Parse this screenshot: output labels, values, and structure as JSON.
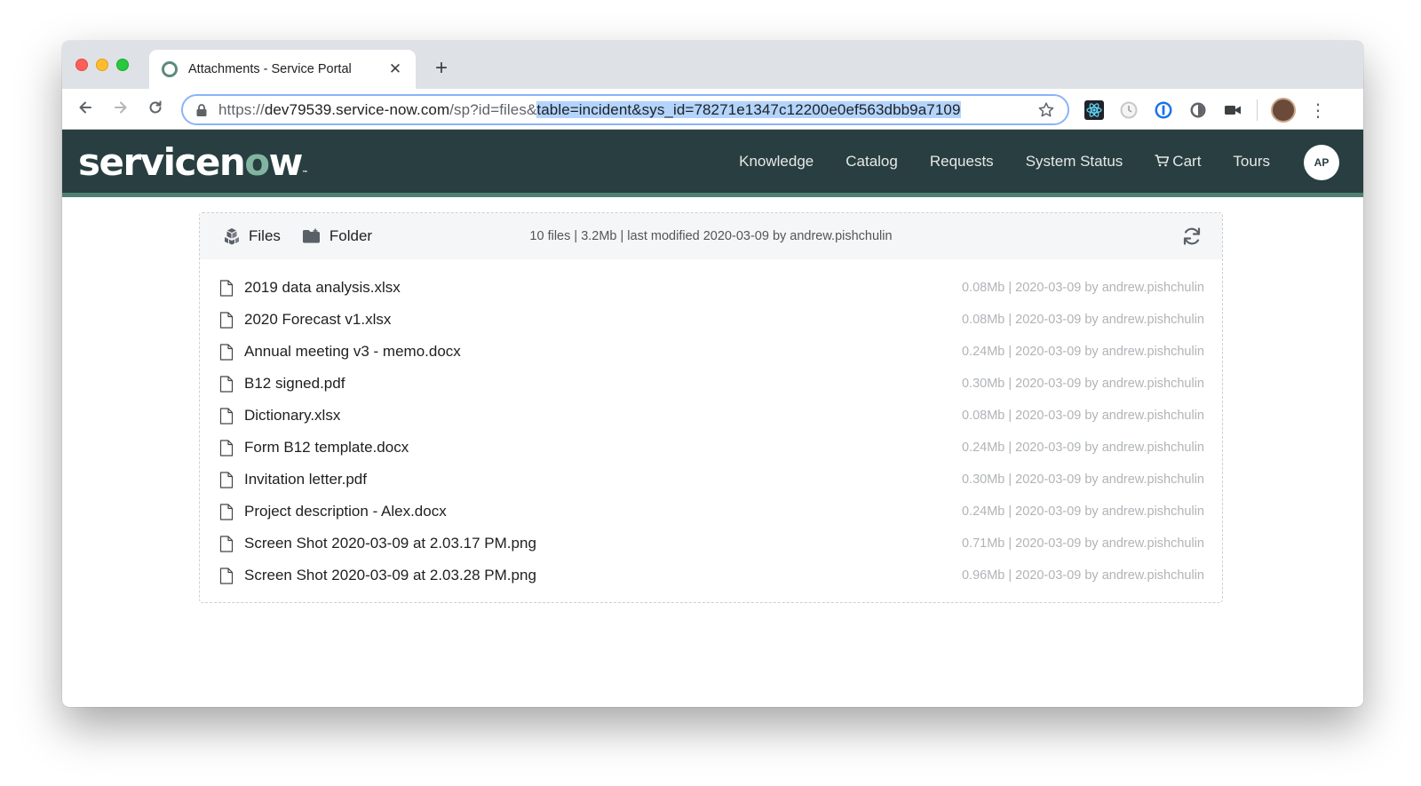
{
  "browser": {
    "tab_title": "Attachments - Service Portal",
    "new_tab": "+",
    "url_scheme": "https://",
    "url_host": "dev79539.service-now.com",
    "url_path": "/sp?id=files&",
    "url_selected": "table=incident&sys_id=78271e1347c12200e0ef563dbb9a7109"
  },
  "header": {
    "logo_pre": "servicen",
    "logo_o": "o",
    "logo_post": "w",
    "nav": {
      "knowledge": "Knowledge",
      "catalog": "Catalog",
      "requests": "Requests",
      "system_status": "System Status",
      "cart": "Cart",
      "tours": "Tours"
    },
    "avatar_initials": "AP"
  },
  "panel": {
    "files_button": "Files",
    "folder_button": "Folder",
    "summary": "10 files | 3.2Mb | last modified 2020-03-09 by andrew.pishchulin"
  },
  "files": [
    {
      "name": "2019 data analysis.xlsx",
      "meta": "0.08Mb | 2020-03-09 by andrew.pishchulin"
    },
    {
      "name": "2020 Forecast v1.xlsx",
      "meta": "0.08Mb | 2020-03-09 by andrew.pishchulin"
    },
    {
      "name": "Annual meeting v3 - memo.docx",
      "meta": "0.24Mb | 2020-03-09 by andrew.pishchulin"
    },
    {
      "name": "B12 signed.pdf",
      "meta": "0.30Mb | 2020-03-09 by andrew.pishchulin"
    },
    {
      "name": "Dictionary.xlsx",
      "meta": "0.08Mb | 2020-03-09 by andrew.pishchulin"
    },
    {
      "name": "Form B12 template.docx",
      "meta": "0.24Mb | 2020-03-09 by andrew.pishchulin"
    },
    {
      "name": "Invitation letter.pdf",
      "meta": "0.30Mb | 2020-03-09 by andrew.pishchulin"
    },
    {
      "name": "Project description - Alex.docx",
      "meta": "0.24Mb | 2020-03-09 by andrew.pishchulin"
    },
    {
      "name": "Screen Shot 2020-03-09 at 2.03.17 PM.png",
      "meta": "0.71Mb | 2020-03-09 by andrew.pishchulin"
    },
    {
      "name": "Screen Shot 2020-03-09 at 2.03.28 PM.png",
      "meta": "0.96Mb | 2020-03-09 by andrew.pishchulin"
    }
  ],
  "icons": {
    "back": "arrow-left-icon",
    "forward": "arrow-right-icon",
    "reload": "reload-icon",
    "lock": "lock-icon",
    "bookmark": "star-icon",
    "files": "cubes-icon",
    "folder": "folder-plus-icon",
    "refresh": "refresh-icon",
    "file": "file-icon",
    "cart": "cart-icon"
  },
  "colors": {
    "header_bg": "#293e40",
    "header_accent": "#4d7f73",
    "logo_accent": "#81b5a1",
    "url_selection": "#b3d4fc"
  }
}
